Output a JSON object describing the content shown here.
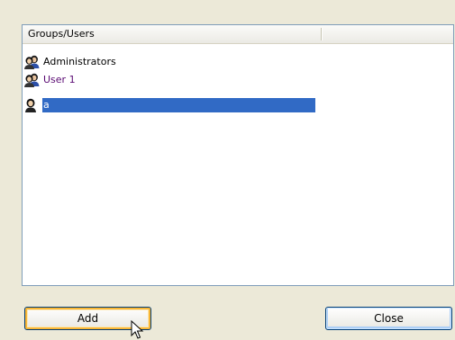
{
  "list": {
    "columns": [
      "Groups/Users",
      ""
    ],
    "items": [
      {
        "label": "Administrators",
        "icon": "group-icon",
        "selected": false
      },
      {
        "label": "User 1",
        "icon": "group-icon",
        "selected": false
      },
      {
        "label": "a",
        "icon": "user-icon",
        "selected": true
      }
    ]
  },
  "buttons": {
    "add_label": "Add",
    "close_label": "Close"
  },
  "colors": {
    "dialog_background": "#ece9d8",
    "selection_highlight": "#316ac5",
    "user1_text": "#5a0a73",
    "list_border": "#7f9db9",
    "focus_ring": "#f8b636"
  }
}
